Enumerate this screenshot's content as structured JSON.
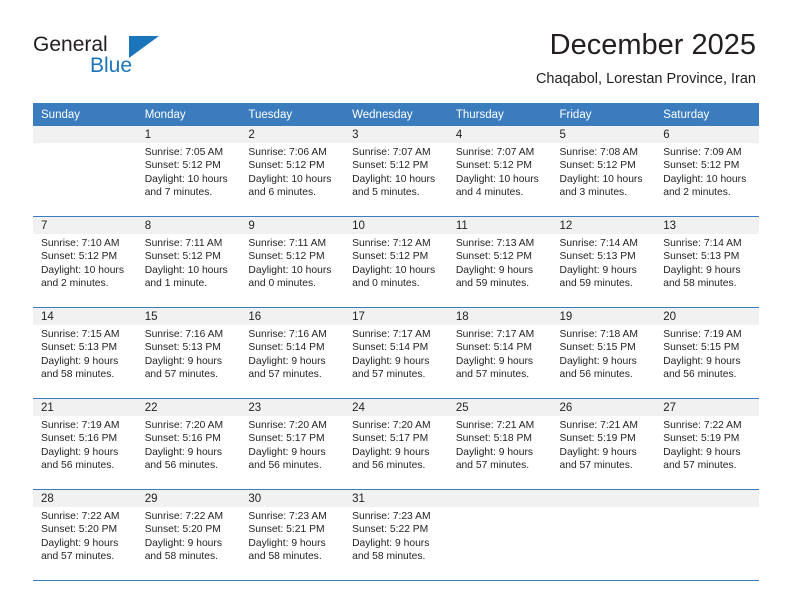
{
  "brand": {
    "name_part1": "General",
    "name_part2": "Blue",
    "accent_color": "#1b75bb"
  },
  "header": {
    "title": "December 2025",
    "subtitle": "Chaqabol, Lorestan Province, Iran"
  },
  "theme": {
    "header_row_color": "#3a7cbe",
    "day_number_bg": "#f1f1f1",
    "text_color": "#231f20"
  },
  "calendar": {
    "weekday_headers": [
      "Sunday",
      "Monday",
      "Tuesday",
      "Wednesday",
      "Thursday",
      "Friday",
      "Saturday"
    ],
    "weeks": [
      [
        {
          "day": "",
          "sunrise": "",
          "sunset": "",
          "daylight_line1": "",
          "daylight_line2": ""
        },
        {
          "day": "1",
          "sunrise": "Sunrise: 7:05 AM",
          "sunset": "Sunset: 5:12 PM",
          "daylight_line1": "Daylight: 10 hours",
          "daylight_line2": "and 7 minutes."
        },
        {
          "day": "2",
          "sunrise": "Sunrise: 7:06 AM",
          "sunset": "Sunset: 5:12 PM",
          "daylight_line1": "Daylight: 10 hours",
          "daylight_line2": "and 6 minutes."
        },
        {
          "day": "3",
          "sunrise": "Sunrise: 7:07 AM",
          "sunset": "Sunset: 5:12 PM",
          "daylight_line1": "Daylight: 10 hours",
          "daylight_line2": "and 5 minutes."
        },
        {
          "day": "4",
          "sunrise": "Sunrise: 7:07 AM",
          "sunset": "Sunset: 5:12 PM",
          "daylight_line1": "Daylight: 10 hours",
          "daylight_line2": "and 4 minutes."
        },
        {
          "day": "5",
          "sunrise": "Sunrise: 7:08 AM",
          "sunset": "Sunset: 5:12 PM",
          "daylight_line1": "Daylight: 10 hours",
          "daylight_line2": "and 3 minutes."
        },
        {
          "day": "6",
          "sunrise": "Sunrise: 7:09 AM",
          "sunset": "Sunset: 5:12 PM",
          "daylight_line1": "Daylight: 10 hours",
          "daylight_line2": "and 2 minutes."
        }
      ],
      [
        {
          "day": "7",
          "sunrise": "Sunrise: 7:10 AM",
          "sunset": "Sunset: 5:12 PM",
          "daylight_line1": "Daylight: 10 hours",
          "daylight_line2": "and 2 minutes."
        },
        {
          "day": "8",
          "sunrise": "Sunrise: 7:11 AM",
          "sunset": "Sunset: 5:12 PM",
          "daylight_line1": "Daylight: 10 hours",
          "daylight_line2": "and 1 minute."
        },
        {
          "day": "9",
          "sunrise": "Sunrise: 7:11 AM",
          "sunset": "Sunset: 5:12 PM",
          "daylight_line1": "Daylight: 10 hours",
          "daylight_line2": "and 0 minutes."
        },
        {
          "day": "10",
          "sunrise": "Sunrise: 7:12 AM",
          "sunset": "Sunset: 5:12 PM",
          "daylight_line1": "Daylight: 10 hours",
          "daylight_line2": "and 0 minutes."
        },
        {
          "day": "11",
          "sunrise": "Sunrise: 7:13 AM",
          "sunset": "Sunset: 5:12 PM",
          "daylight_line1": "Daylight: 9 hours",
          "daylight_line2": "and 59 minutes."
        },
        {
          "day": "12",
          "sunrise": "Sunrise: 7:14 AM",
          "sunset": "Sunset: 5:13 PM",
          "daylight_line1": "Daylight: 9 hours",
          "daylight_line2": "and 59 minutes."
        },
        {
          "day": "13",
          "sunrise": "Sunrise: 7:14 AM",
          "sunset": "Sunset: 5:13 PM",
          "daylight_line1": "Daylight: 9 hours",
          "daylight_line2": "and 58 minutes."
        }
      ],
      [
        {
          "day": "14",
          "sunrise": "Sunrise: 7:15 AM",
          "sunset": "Sunset: 5:13 PM",
          "daylight_line1": "Daylight: 9 hours",
          "daylight_line2": "and 58 minutes."
        },
        {
          "day": "15",
          "sunrise": "Sunrise: 7:16 AM",
          "sunset": "Sunset: 5:13 PM",
          "daylight_line1": "Daylight: 9 hours",
          "daylight_line2": "and 57 minutes."
        },
        {
          "day": "16",
          "sunrise": "Sunrise: 7:16 AM",
          "sunset": "Sunset: 5:14 PM",
          "daylight_line1": "Daylight: 9 hours",
          "daylight_line2": "and 57 minutes."
        },
        {
          "day": "17",
          "sunrise": "Sunrise: 7:17 AM",
          "sunset": "Sunset: 5:14 PM",
          "daylight_line1": "Daylight: 9 hours",
          "daylight_line2": "and 57 minutes."
        },
        {
          "day": "18",
          "sunrise": "Sunrise: 7:17 AM",
          "sunset": "Sunset: 5:14 PM",
          "daylight_line1": "Daylight: 9 hours",
          "daylight_line2": "and 57 minutes."
        },
        {
          "day": "19",
          "sunrise": "Sunrise: 7:18 AM",
          "sunset": "Sunset: 5:15 PM",
          "daylight_line1": "Daylight: 9 hours",
          "daylight_line2": "and 56 minutes."
        },
        {
          "day": "20",
          "sunrise": "Sunrise: 7:19 AM",
          "sunset": "Sunset: 5:15 PM",
          "daylight_line1": "Daylight: 9 hours",
          "daylight_line2": "and 56 minutes."
        }
      ],
      [
        {
          "day": "21",
          "sunrise": "Sunrise: 7:19 AM",
          "sunset": "Sunset: 5:16 PM",
          "daylight_line1": "Daylight: 9 hours",
          "daylight_line2": "and 56 minutes."
        },
        {
          "day": "22",
          "sunrise": "Sunrise: 7:20 AM",
          "sunset": "Sunset: 5:16 PM",
          "daylight_line1": "Daylight: 9 hours",
          "daylight_line2": "and 56 minutes."
        },
        {
          "day": "23",
          "sunrise": "Sunrise: 7:20 AM",
          "sunset": "Sunset: 5:17 PM",
          "daylight_line1": "Daylight: 9 hours",
          "daylight_line2": "and 56 minutes."
        },
        {
          "day": "24",
          "sunrise": "Sunrise: 7:20 AM",
          "sunset": "Sunset: 5:17 PM",
          "daylight_line1": "Daylight: 9 hours",
          "daylight_line2": "and 56 minutes."
        },
        {
          "day": "25",
          "sunrise": "Sunrise: 7:21 AM",
          "sunset": "Sunset: 5:18 PM",
          "daylight_line1": "Daylight: 9 hours",
          "daylight_line2": "and 57 minutes."
        },
        {
          "day": "26",
          "sunrise": "Sunrise: 7:21 AM",
          "sunset": "Sunset: 5:19 PM",
          "daylight_line1": "Daylight: 9 hours",
          "daylight_line2": "and 57 minutes."
        },
        {
          "day": "27",
          "sunrise": "Sunrise: 7:22 AM",
          "sunset": "Sunset: 5:19 PM",
          "daylight_line1": "Daylight: 9 hours",
          "daylight_line2": "and 57 minutes."
        }
      ],
      [
        {
          "day": "28",
          "sunrise": "Sunrise: 7:22 AM",
          "sunset": "Sunset: 5:20 PM",
          "daylight_line1": "Daylight: 9 hours",
          "daylight_line2": "and 57 minutes."
        },
        {
          "day": "29",
          "sunrise": "Sunrise: 7:22 AM",
          "sunset": "Sunset: 5:20 PM",
          "daylight_line1": "Daylight: 9 hours",
          "daylight_line2": "and 58 minutes."
        },
        {
          "day": "30",
          "sunrise": "Sunrise: 7:23 AM",
          "sunset": "Sunset: 5:21 PM",
          "daylight_line1": "Daylight: 9 hours",
          "daylight_line2": "and 58 minutes."
        },
        {
          "day": "31",
          "sunrise": "Sunrise: 7:23 AM",
          "sunset": "Sunset: 5:22 PM",
          "daylight_line1": "Daylight: 9 hours",
          "daylight_line2": "and 58 minutes."
        },
        {
          "day": "",
          "sunrise": "",
          "sunset": "",
          "daylight_line1": "",
          "daylight_line2": ""
        },
        {
          "day": "",
          "sunrise": "",
          "sunset": "",
          "daylight_line1": "",
          "daylight_line2": ""
        },
        {
          "day": "",
          "sunrise": "",
          "sunset": "",
          "daylight_line1": "",
          "daylight_line2": ""
        }
      ]
    ]
  }
}
